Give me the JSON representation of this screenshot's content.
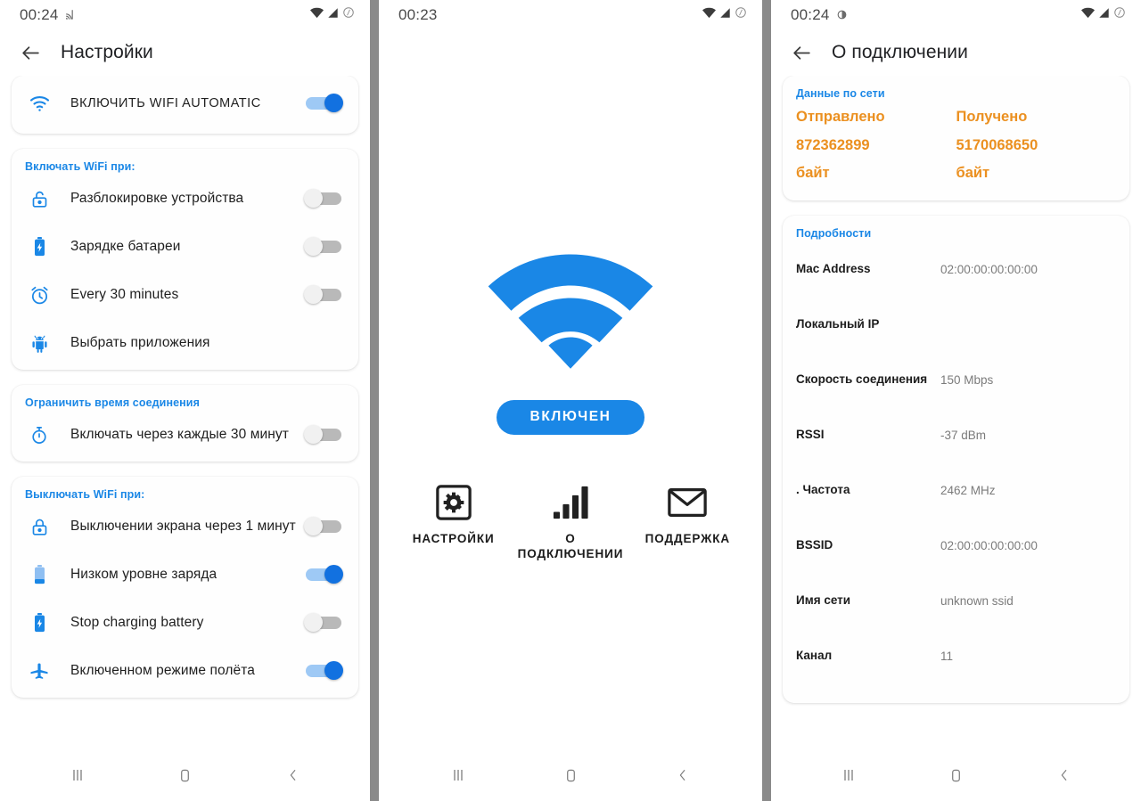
{
  "colors": {
    "accent_blue": "#1a87e6",
    "toggle_on": "#1271e0",
    "orange": "#eb9020",
    "divider_gray": "#8a8a8a",
    "muted_text": "#7b7b7b"
  },
  "screen_settings": {
    "status_bar": {
      "time": "00:24"
    },
    "appbar": {
      "title": "Настройки"
    },
    "main_toggle": {
      "icon": "wifi-icon",
      "label": "ВКЛЮЧИТЬ WIFI AUTOMATIC",
      "state": "on"
    },
    "sections": [
      {
        "title": "Включать WiFi при:",
        "rows": [
          {
            "icon": "unlock-icon",
            "label": "Разблокировке устройства",
            "toggle": "off"
          },
          {
            "icon": "battery-charging-icon",
            "label": "Зарядке батареи",
            "toggle": "off"
          },
          {
            "icon": "alarm-clock-icon",
            "label": "Every 30 minutes",
            "toggle": "off"
          },
          {
            "icon": "android-icon",
            "label": "Выбрать приложения",
            "toggle": "none"
          }
        ]
      },
      {
        "title": "Ограничить время соединения",
        "rows": [
          {
            "icon": "stopwatch-icon",
            "label": "Включать через каждые  30 минут",
            "toggle": "off"
          }
        ]
      },
      {
        "title": "Выключать WiFi при:",
        "rows": [
          {
            "icon": "lock-icon",
            "label": "Выключении экрана через 1 минут",
            "toggle": "off"
          },
          {
            "icon": "battery-low-icon",
            "label": "Низком уровне заряда",
            "toggle": "on"
          },
          {
            "icon": "battery-charging-icon",
            "label": "Stop charging battery",
            "toggle": "off"
          },
          {
            "icon": "airplane-icon",
            "label": "Включенном режиме полёта",
            "toggle": "on"
          }
        ]
      }
    ],
    "navbar": {
      "recents": "|||",
      "home": "home-icon",
      "back": "back-icon"
    }
  },
  "screen_home": {
    "status_bar": {
      "time": "00:23"
    },
    "logo": "wifi-logo-icon",
    "status_pill": {
      "label": "ВКЛЮЧЕН"
    },
    "actions": [
      {
        "icon": "gear-in-square-icon",
        "label": "НАСТРОЙКИ"
      },
      {
        "icon": "signal-bars-icon",
        "label": "О ПОДКЛЮЧЕНИИ"
      },
      {
        "icon": "envelope-icon",
        "label": "ПОДДЕРЖКА"
      }
    ]
  },
  "screen_connection": {
    "status_bar": {
      "time": "00:24"
    },
    "appbar": {
      "title": "О подключении"
    },
    "network_card": {
      "title": "Данные по сети",
      "sent": {
        "label": "Отправлено",
        "value": "872362899",
        "unit": "байт"
      },
      "received": {
        "label": "Получено",
        "value": "5170068650",
        "unit": "байт"
      }
    },
    "details_card": {
      "title": "Подробности",
      "rows": [
        {
          "key": "Mac Address",
          "value": "02:00:00:00:00:00"
        },
        {
          "key": "Локальный IP",
          "value": ""
        },
        {
          "key": "Скорость соединения",
          "value": "150 Mbps"
        },
        {
          "key": "RSSI",
          "value": "-37 dBm"
        },
        {
          "key": ". Частота",
          "value": "2462 MHz"
        },
        {
          "key": "BSSID",
          "value": "02:00:00:00:00:00"
        },
        {
          "key": "Имя сети",
          "value": "unknown ssid"
        },
        {
          "key": "Канал",
          "value": "11"
        }
      ]
    }
  }
}
